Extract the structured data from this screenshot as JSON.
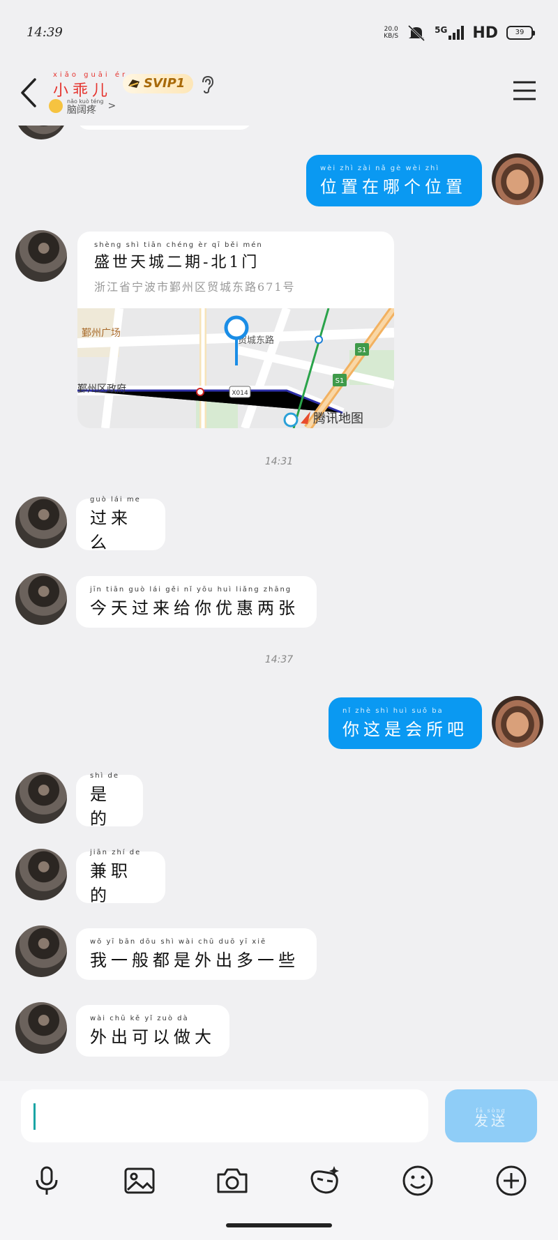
{
  "status": {
    "time": "14:39",
    "net_speed_value": "20.0",
    "net_speed_unit": "KB/S",
    "network": "5G",
    "hd": "HD",
    "battery": "39"
  },
  "header": {
    "contact_name": "小乖儿",
    "contact_name_pinyin": "xiǎo guāi ér",
    "badge": "SVIP1",
    "status_text": "脑阔疼",
    "status_pinyin": "nǎo kuò téng",
    "status_chevron": ">"
  },
  "chat": {
    "msg_me_1": {
      "pinyin": "wèi zhì zài nǎ gè wèi zhì",
      "text": "位置在哪个位置"
    },
    "location": {
      "title_pinyin": "shèng shì tiān chéng èr qī běi mén",
      "title": "盛世天城二期-北1门",
      "address": "浙江省宁波市鄞州区贸城东路671号",
      "map_labels": {
        "area1": "鄞州广场",
        "area2": "鄞州区政府",
        "road_code": "X014",
        "highway": "S1",
        "brand": "腾讯地图",
        "road_name": "贸城东路"
      }
    },
    "time_1": "14:31",
    "msg_her_1": {
      "pinyin": "guò lái me",
      "text": "过来么"
    },
    "msg_her_2": {
      "pinyin": "jīn tiān guò lái gěi nǐ yōu huì liǎng zhāng",
      "text": "今天过来给你优惠两张"
    },
    "time_2": "14:37",
    "msg_me_2": {
      "pinyin": "nǐ zhè shì huì suǒ ba",
      "text": "你这是会所吧"
    },
    "msg_her_3": {
      "pinyin": "shì de",
      "text": "是的"
    },
    "msg_her_4": {
      "pinyin": "jiān zhí de",
      "text": "兼职的"
    },
    "msg_her_5": {
      "pinyin": "wǒ yī bān dōu shì wài chū duō yī xiē",
      "text": "我一般都是外出多一些"
    },
    "msg_her_6": {
      "pinyin": "wài chū kě yǐ zuò dà",
      "text": "外出可以做大"
    }
  },
  "input": {
    "value": "",
    "send_label": "发送",
    "send_pinyin": "fā sòng"
  },
  "icons": [
    "back-icon",
    "svip-icon",
    "ear-icon",
    "menu-icon",
    "mic-icon",
    "image-icon",
    "camera-icon",
    "sticker-icon",
    "emoji-icon",
    "plus-icon",
    "location-pin-icon"
  ]
}
